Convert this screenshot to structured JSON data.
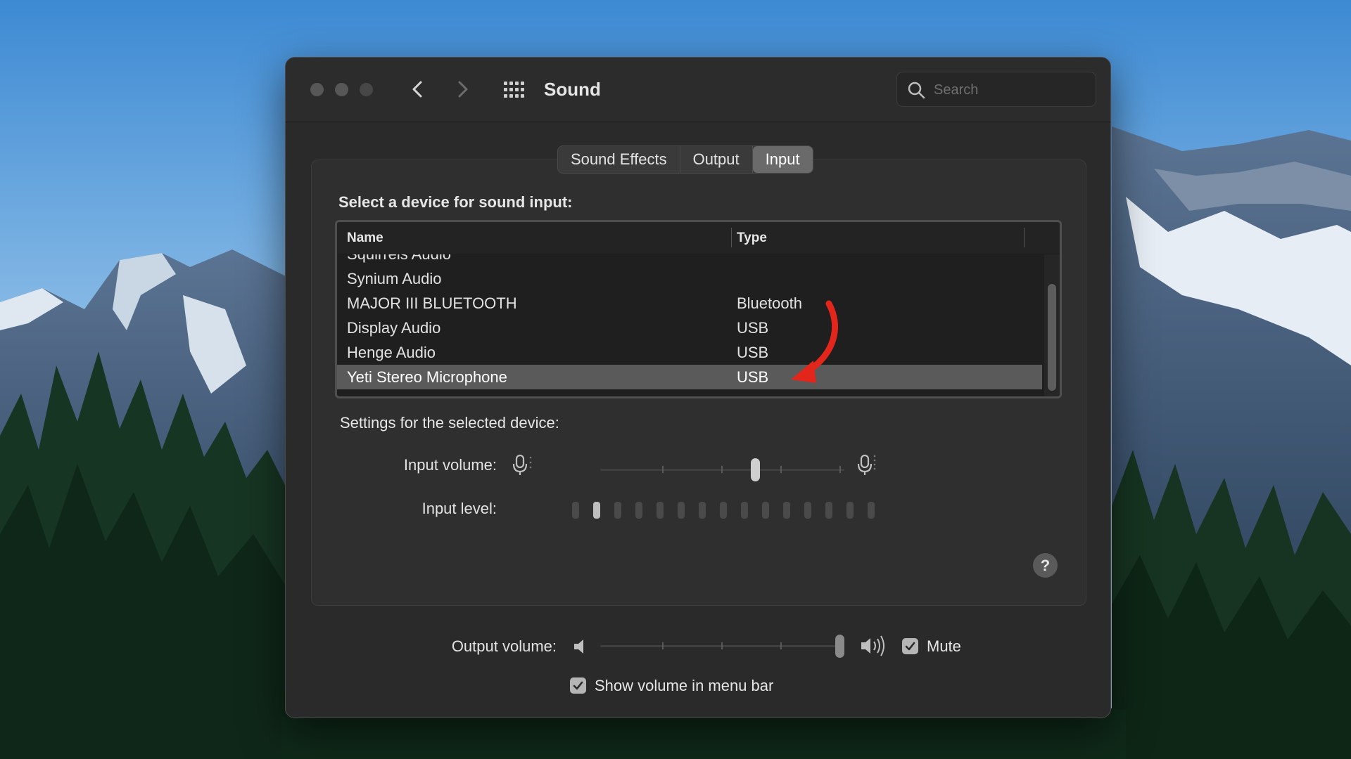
{
  "window": {
    "title": "Sound",
    "search": {
      "placeholder": "Search"
    }
  },
  "tabs": [
    {
      "label": "Sound Effects",
      "active": false
    },
    {
      "label": "Output",
      "active": false
    },
    {
      "label": "Input",
      "active": true
    }
  ],
  "input_panel": {
    "device_heading": "Select a device for sound input:",
    "columns": [
      "Name",
      "Type"
    ],
    "devices": [
      {
        "name": "Squirrels Audio",
        "type": ""
      },
      {
        "name": "Synium Audio",
        "type": ""
      },
      {
        "name": "MAJOR III BLUETOOTH",
        "type": "Bluetooth"
      },
      {
        "name": "Display Audio",
        "type": "USB"
      },
      {
        "name": "Henge Audio",
        "type": "USB"
      },
      {
        "name": "Yeti Stereo Microphone",
        "type": "USB",
        "selected": true
      }
    ],
    "settings_heading": "Settings for the selected device:",
    "input_volume_label": "Input volume:",
    "input_volume_level": 0.64,
    "input_level_label": "Input level:",
    "input_level_lit": 2,
    "input_level_total": 15,
    "help_symbol": "?"
  },
  "bottom": {
    "output_volume_label": "Output volume:",
    "output_volume_level": 1.0,
    "mute_label": "Mute",
    "mute_checked": true,
    "show_volume_label": "Show volume in menu bar",
    "show_volume_checked": true
  },
  "colors": {
    "annotation_arrow": "#e2261c",
    "window_bg": "#2a2a2a",
    "selected_row": "#5a5a5a"
  }
}
